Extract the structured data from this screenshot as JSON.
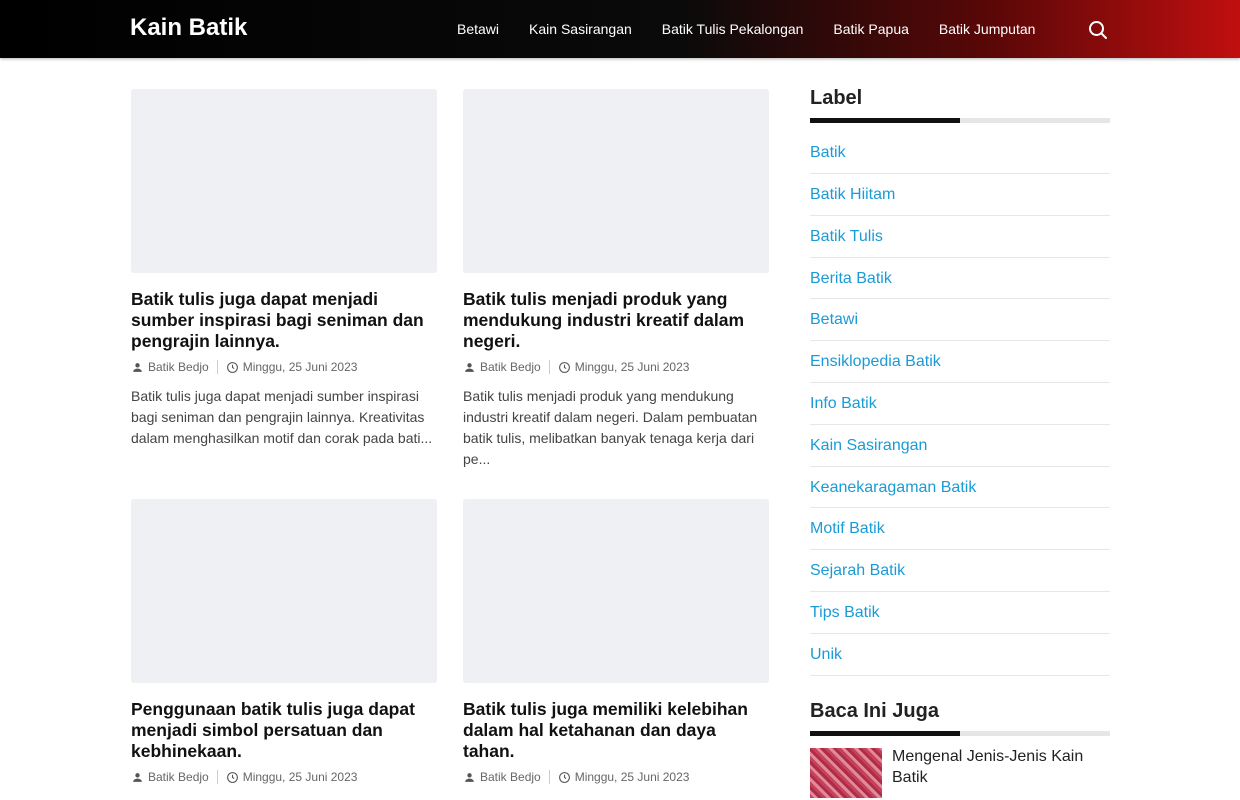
{
  "header": {
    "brand": "Kain Batik",
    "menu": [
      "Betawi",
      "Kain Sasirangan",
      "Batik Tulis Pekalongan",
      "Batik Papua",
      "Batik Jumputan"
    ]
  },
  "posts": [
    {
      "title": "Batik tulis juga dapat menjadi sumber inspirasi bagi seniman dan pengrajin lainnya.",
      "author": "Batik Bedjo",
      "date": "Minggu, 25 Juni 2023",
      "excerpt": "Batik tulis juga dapat menjadi sumber inspirasi bagi seniman dan pengrajin lainnya. Kreativitas dalam menghasilkan motif dan corak pada bati..."
    },
    {
      "title": "Batik tulis menjadi produk yang mendukung industri kreatif dalam negeri.",
      "author": "Batik Bedjo",
      "date": "Minggu, 25 Juni 2023",
      "excerpt": "Batik tulis menjadi produk yang mendukung industri kreatif dalam negeri. Dalam pembuatan batik tulis, melibatkan banyak tenaga kerja dari pe..."
    },
    {
      "title": "Penggunaan batik tulis juga dapat menjadi simbol persatuan dan kebhinekaan.",
      "author": "Batik Bedjo",
      "date": "Minggu, 25 Juni 2023"
    },
    {
      "title": "Batik tulis juga memiliki kelebihan dalam hal ketahanan dan daya tahan.",
      "author": "Batik Bedjo",
      "date": "Minggu, 25 Juni 2023"
    }
  ],
  "sidebar": {
    "label_title": "Label",
    "labels": [
      "Batik",
      "Batik Hiitam",
      "Batik Tulis",
      "Berita Batik",
      "Betawi",
      "Ensiklopedia Batik",
      "Info Batik",
      "Kain Sasirangan",
      "Keanekaragaman Batik",
      "Motif Batik",
      "Sejarah Batik",
      "Tips Batik",
      "Unik"
    ],
    "baca_title": "Baca Ini Juga",
    "baca_items": [
      "Mengenal Jenis-Jenis Kain Batik"
    ]
  },
  "colors": {
    "link": "#1a9bd7",
    "nav_start": "#000000",
    "nav_end": "#c10f0f"
  }
}
